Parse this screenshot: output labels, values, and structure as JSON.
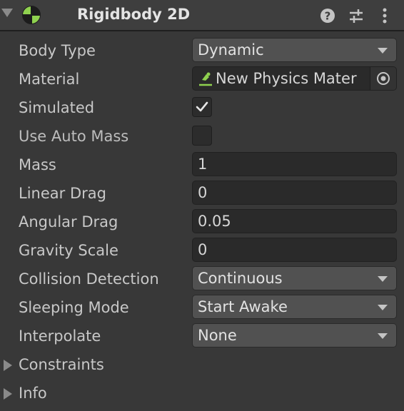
{
  "component": {
    "title": "Rigidbody 2D",
    "icon": "rigidbody-2d-icon",
    "accent_color": "#8fd14f",
    "header_icons": [
      "help-icon",
      "presets-icon",
      "more-options-icon"
    ]
  },
  "properties": {
    "body_type": {
      "label": "Body Type",
      "value": "Dynamic"
    },
    "material": {
      "label": "Material",
      "value": "New Physics Mater",
      "icon": "physics-material-icon",
      "picker_icon": "object-picker-icon"
    },
    "simulated": {
      "label": "Simulated",
      "checked": true
    },
    "use_auto_mass": {
      "label": "Use Auto Mass",
      "checked": false
    },
    "mass": {
      "label": "Mass",
      "value": "1"
    },
    "linear_drag": {
      "label": "Linear Drag",
      "value": "0"
    },
    "angular_drag": {
      "label": "Angular Drag",
      "value": "0.05"
    },
    "gravity_scale": {
      "label": "Gravity Scale",
      "value": "0"
    },
    "collision_detection": {
      "label": "Collision Detection",
      "value": "Continuous"
    },
    "sleeping_mode": {
      "label": "Sleeping Mode",
      "value": "Start Awake"
    },
    "interpolate": {
      "label": "Interpolate",
      "value": "None"
    }
  },
  "foldouts": {
    "constraints": {
      "label": "Constraints",
      "expanded": false
    },
    "info": {
      "label": "Info",
      "expanded": false
    }
  }
}
